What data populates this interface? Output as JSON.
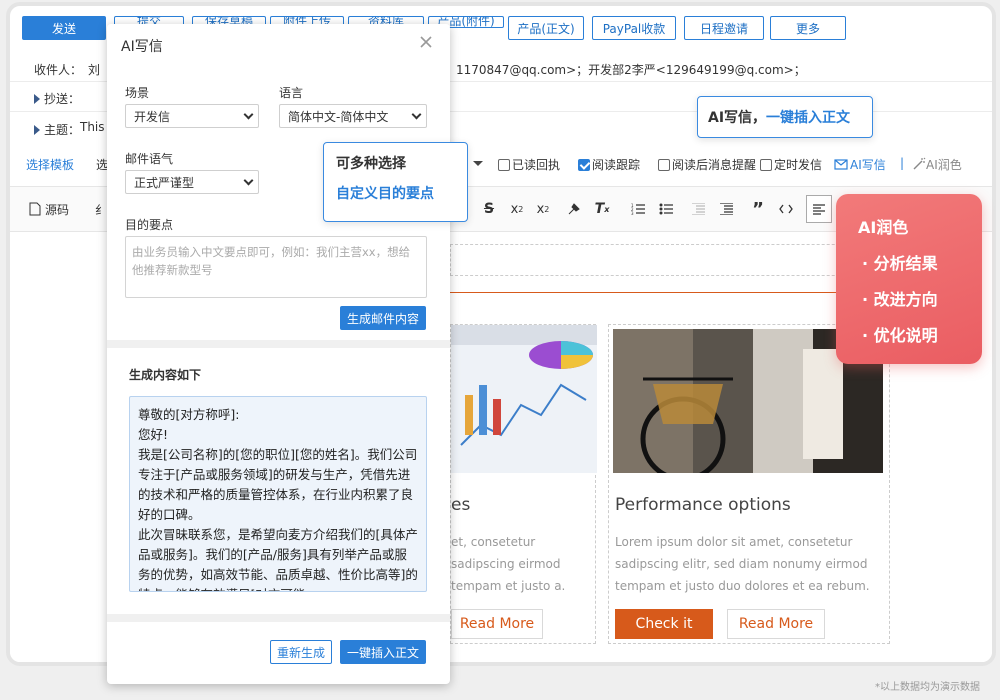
{
  "toolbar": {
    "send": "发送",
    "submit": "提交",
    "save_draft": "保存草稿",
    "attach": "附件上传",
    "library": "资料库",
    "product_attach": "产品(附件)",
    "product_body": "产品(正文)",
    "paypal": "PayPal收款",
    "schedule": "日程邀请",
    "more": "更多"
  },
  "header": {
    "to_label": "收件人：",
    "to_value_start": "刘",
    "to_value_rest": "1170847@qq.com>；开发部2李严<129649199@q.com>；",
    "cc_label": "抄送：",
    "subject_label": "主题：",
    "subject_value": "This"
  },
  "options": {
    "template_link": "选择模板",
    "template_trunc": "选",
    "read_receipt": "已读回执",
    "read_tracking": "阅读跟踪",
    "remind_after_read": "阅读后消息提醒",
    "scheduled_send": "定时发信",
    "ai_write": "AI写信",
    "separator": "|",
    "ai_polish": "AI润色"
  },
  "format_bar": {
    "source": "源码",
    "trunc": "纟"
  },
  "dialog": {
    "title": "AI写信",
    "scene_label": "场景",
    "scene_value": "开发信",
    "language_label": "语言",
    "language_value": "简体中文-简体中文",
    "tone_label": "邮件语气",
    "tone_value": "正式严谨型",
    "goal_label": "目的要点",
    "goal_placeholder": "由业务员输入中文要点即可，例如：我们主营xx，想给他推荐新款型号",
    "generate_btn": "生成邮件内容",
    "result_label": "生成内容如下",
    "result_lines": [
      "尊敬的[对方称呼]:",
      "您好!",
      "我是[公司名称]的[您的职位][您的姓名]。我们公司专注于[产品或服务领域]的研发与生产，凭借先进的技术和严格的质量管控体系，在行业内积累了良好的口碑。",
      "此次冒昧联系您，是希望向麦方介绍我们的[具体产品或服务]。我们的[产品/服务]具有列举产品或服务的优势，如高效节能、品质卓越、性价比高等]的特点，能够有效满足[对方可能"
    ],
    "regenerate_btn": "重新生成",
    "insert_btn": "一键插入正文"
  },
  "callout_insert": {
    "part1": "AI写信，",
    "part2": "一键插入正文"
  },
  "callout_choice": {
    "line1": "可多种选择",
    "line2": "自定义目的要点"
  },
  "polish_panel": {
    "title": "AI润色",
    "items": [
      "· 分析结果",
      "· 改进方向",
      "· 优化说明"
    ]
  },
  "cards": {
    "left_title_trunc": "es",
    "left_text": "et, consetetur sadipscing eirmod tempam et justo a.",
    "right_title": "Performance options",
    "right_text": "Lorem ipsum dolor sit amet, consetetur sadipscing elitr, sed diam nonumy eirmod tempam et justo duo dolores et ea rebum.",
    "read_more": "Read More",
    "check_it": "Check it"
  },
  "footnote": "*以上数据均为演示数据",
  "colors": {
    "primary": "#2a7fd8",
    "accent_orange": "#d75a1b",
    "polish_red": "#ea5d62"
  }
}
